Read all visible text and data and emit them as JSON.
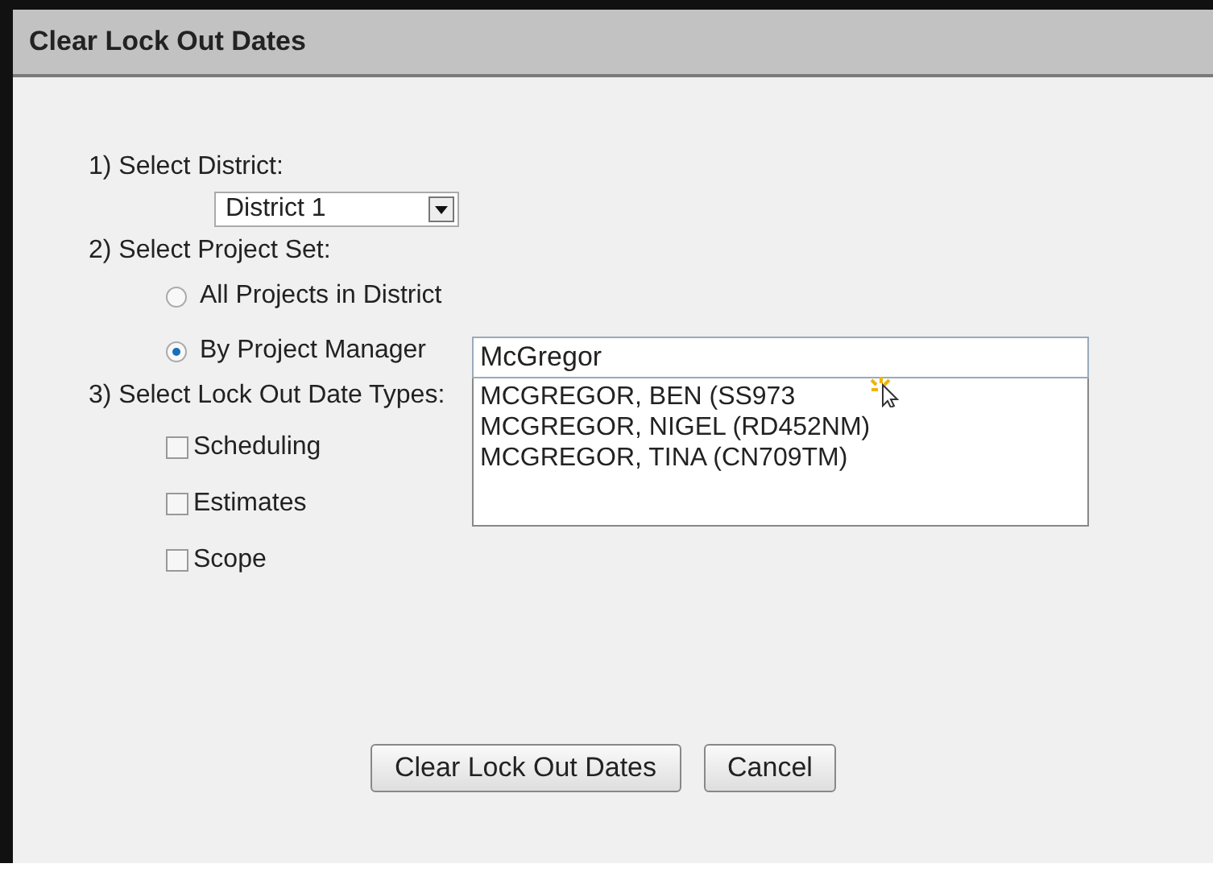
{
  "window": {
    "title": "Clear Lock Out Dates"
  },
  "district": {
    "label": "1) Select District:",
    "value": "District 1"
  },
  "project_set": {
    "label": "2) Select Project Set:",
    "options": [
      {
        "label": "All Projects in District",
        "selected": false
      },
      {
        "label": "By Project Manager",
        "selected": true
      }
    ]
  },
  "manager_search": {
    "value": "McGregor",
    "suggestions": [
      {
        "label": "MCGREGOR, BEN (SS973"
      },
      {
        "label": "MCGREGOR, NIGEL (RD452NM)"
      },
      {
        "label": "MCGREGOR, TINA (CN709TM)"
      }
    ]
  },
  "date_types": {
    "label": "3) Select Lock Out Date Types:",
    "options": [
      {
        "label": "Scheduling",
        "checked": false
      },
      {
        "label": "Estimates",
        "checked": false
      },
      {
        "label": "Scope",
        "checked": false
      }
    ]
  },
  "buttons": [
    "Clear Lock Out Dates",
    "Cancel"
  ]
}
